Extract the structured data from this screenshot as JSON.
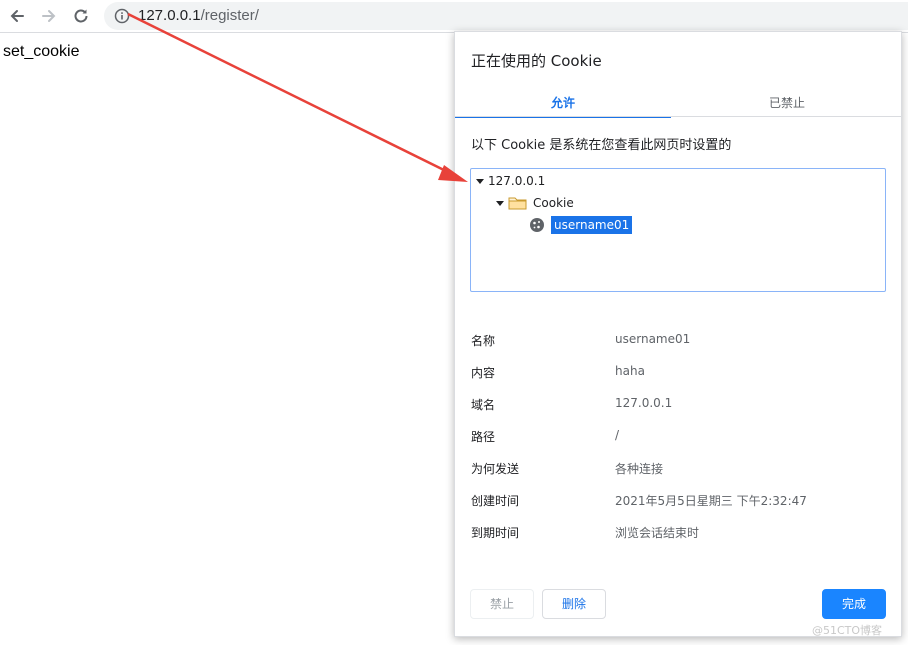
{
  "browser": {
    "url_host": "127.0.0.1",
    "url_path": "/register/",
    "icons": {
      "back": "arrow-left-icon",
      "forward": "arrow-right-icon",
      "reload": "reload-icon",
      "info": "info-icon"
    }
  },
  "page": {
    "body_text": "set_cookie"
  },
  "dialog": {
    "title": "正在使用的 Cookie",
    "tabs": [
      {
        "label": "允许",
        "active": true
      },
      {
        "label": "已禁止",
        "active": false
      }
    ],
    "description": "以下 Cookie 是系统在您查看此网页时设置的",
    "tree": {
      "site": "127.0.0.1",
      "folder": "Cookie",
      "cookie": "username01"
    },
    "details": [
      {
        "key": "名称",
        "value": "username01"
      },
      {
        "key": "内容",
        "value": "haha"
      },
      {
        "key": "域名",
        "value": "127.0.0.1"
      },
      {
        "key": "路径",
        "value": "/"
      },
      {
        "key": "为何发送",
        "value": "各种连接"
      },
      {
        "key": "创建时间",
        "value": "2021年5月5日星期三 下午2:32:47"
      },
      {
        "key": "到期时间",
        "value": "浏览会话结束时"
      }
    ],
    "buttons": {
      "block": "禁止",
      "delete": "删除",
      "done": "完成"
    }
  },
  "colors": {
    "accent": "#1a73e8",
    "annotation_arrow": "#e8423a"
  },
  "watermark": "@51CTO博客"
}
